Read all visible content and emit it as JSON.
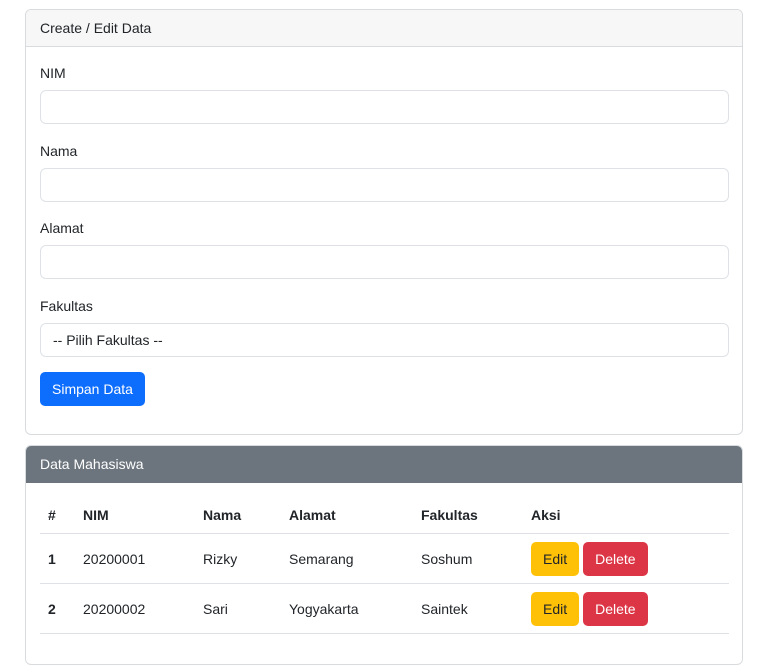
{
  "form_card": {
    "title": "Create / Edit Data",
    "fields": {
      "nim_label": "NIM",
      "nama_label": "Nama",
      "alamat_label": "Alamat",
      "fakultas_label": "Fakultas",
      "fakultas_selected": "-- Pilih Fakultas --"
    },
    "save_label": "Simpan Data"
  },
  "table_card": {
    "title": "Data Mahasiswa",
    "columns": [
      "#",
      "NIM",
      "Nama",
      "Alamat",
      "Fakultas",
      "Aksi"
    ],
    "rows": [
      {
        "no": "1",
        "nim": "20200001",
        "nama": "Rizky",
        "alamat": "Semarang",
        "fakultas": "Soshum"
      },
      {
        "no": "2",
        "nim": "20200002",
        "nama": "Sari",
        "alamat": "Yogyakarta",
        "fakultas": "Saintek"
      }
    ],
    "edit_label": "Edit",
    "delete_label": "Delete"
  },
  "colors": {
    "primary": "#0d6efd",
    "warning": "#ffc107",
    "danger": "#dc3545",
    "secondary": "#6c757d"
  }
}
